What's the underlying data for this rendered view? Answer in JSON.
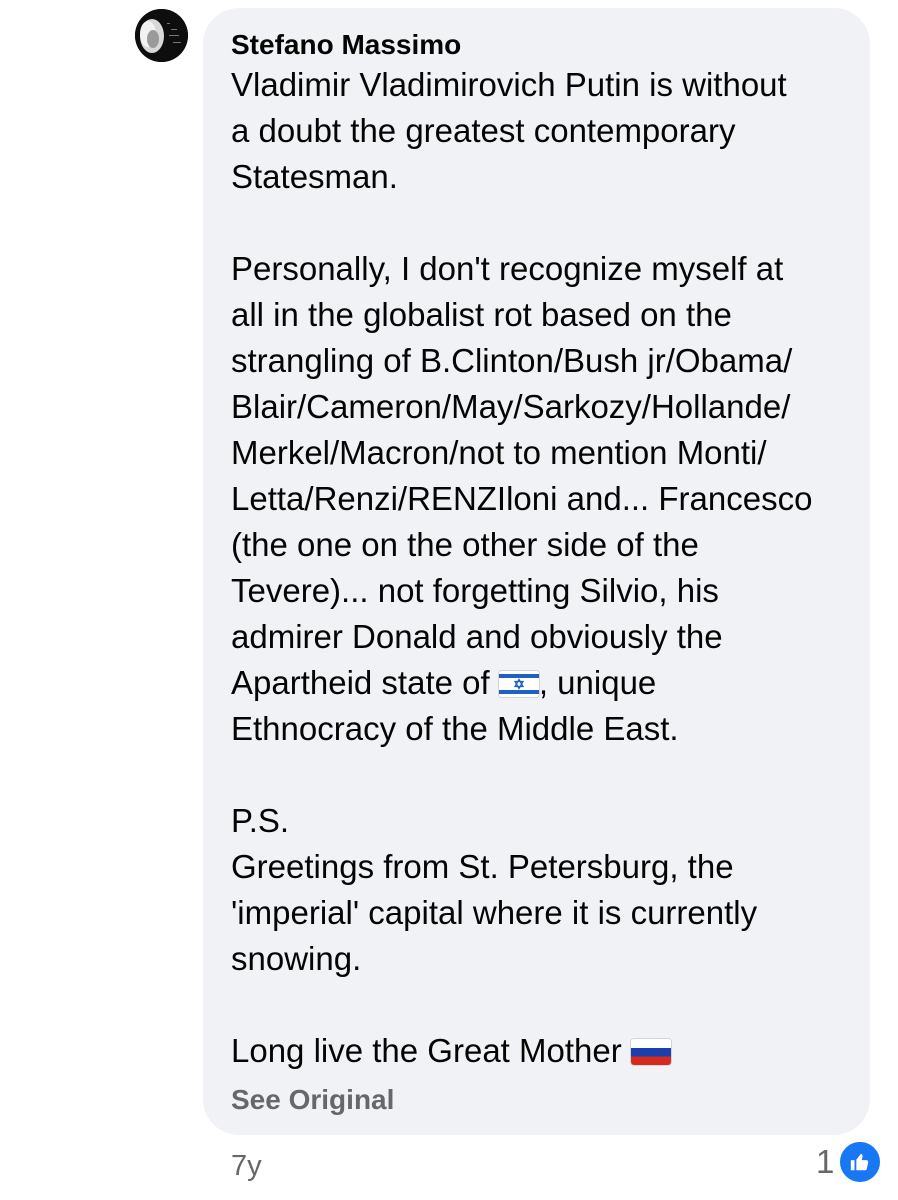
{
  "comment": {
    "author": "Stefano Massimo",
    "paragraphs": [
      [
        "Vladimir Vladimirovich Putin is without",
        "a doubt the greatest contemporary",
        "Statesman."
      ],
      [
        "Personally, I don't recognize myself at",
        "all in the globalist rot based on the",
        "strangling of B.Clinton/Bush jr/Obama/",
        "Blair/Cameron/May/Sarkozy/Hollande/",
        "Merkel/Macron/not to mention Monti/",
        "Letta/Renzi/RENZIloni and... Francesco",
        "(the one on the other side of the",
        "Tevere)... not forgetting Silvio, his",
        "admirer Donald and obviously the"
      ],
      [
        "P.S.",
        "Greetings from St. Petersburg, the",
        "'imperial' capital where it is currently",
        "snowing."
      ]
    ],
    "apartheid_line_before": "Apartheid state of",
    "apartheid_line_after": ", unique",
    "ethnocracy_line": "Ethnocracy of the Middle East.",
    "flag_israel_icon": "israel-flag-icon",
    "last_line_text": "Long live the Great Mother",
    "flag_russia_icon": "russia-flag-icon",
    "see_original": "See Original",
    "time_ago": "7y",
    "reaction_count": "1",
    "reaction_icon": "like-icon",
    "colors": {
      "bubble_bg": "#f0f2f5",
      "secondary_text": "#65676b",
      "like_blue": "#1877f2"
    }
  }
}
